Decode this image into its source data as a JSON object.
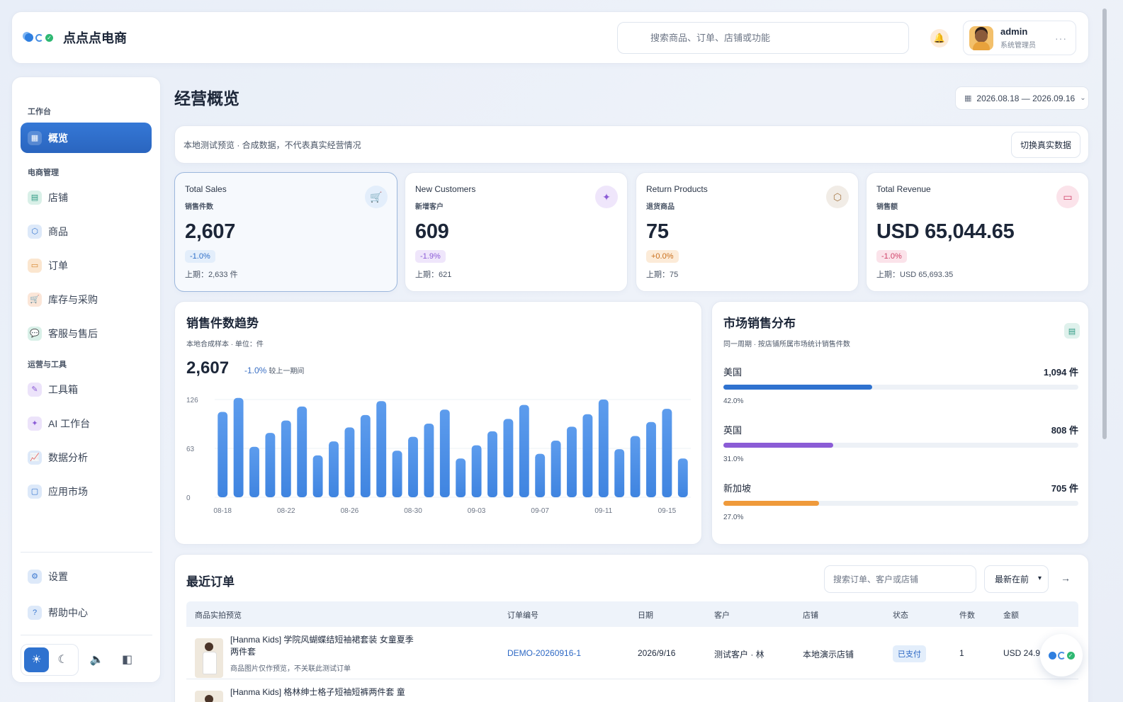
{
  "header": {
    "brand": "点点点电商",
    "search_placeholder": "搜索商品、订单、店铺或功能",
    "user_name": "admin",
    "user_role": "系统管理员"
  },
  "sidebar": {
    "sections": [
      {
        "label": "工作台"
      },
      {
        "label": "电商管理"
      },
      {
        "label": "运营与工具"
      }
    ],
    "items": [
      {
        "label": "概览",
        "icon": "grid-icon"
      },
      {
        "label": "店铺",
        "icon": "store-icon"
      },
      {
        "label": "商品",
        "icon": "box-icon"
      },
      {
        "label": "订单",
        "icon": "order-icon"
      },
      {
        "label": "库存与采购",
        "icon": "cart-icon"
      },
      {
        "label": "客服与售后",
        "icon": "chat-icon"
      },
      {
        "label": "工具箱",
        "icon": "magic-wand-icon"
      },
      {
        "label": "AI 工作台",
        "icon": "ai-star-icon"
      },
      {
        "label": "数据分析",
        "icon": "analytics-icon"
      },
      {
        "label": "应用市场",
        "icon": "app-market-icon"
      }
    ],
    "footer_items": [
      {
        "label": "设置",
        "icon": "gear-icon"
      },
      {
        "label": "帮助中心",
        "icon": "help-icon"
      }
    ]
  },
  "page": {
    "title": "经营概览",
    "date_range": "2026.08.18 — 2026.09.16",
    "notice": "本地测试预览 · 合成数据，不代表真实经营情况",
    "switch_button": "切换真实数据"
  },
  "kpis": [
    {
      "title": "Total Sales",
      "sub": "销售件数",
      "value": "2,607",
      "change": "-1.0%",
      "prev": "上期：2,633 件",
      "color": "#2f72cf"
    },
    {
      "title": "New Customers",
      "sub": "新增客户",
      "value": "609",
      "change": "-1.9%",
      "prev": "上期：621",
      "color": "#8b5cd6"
    },
    {
      "title": "Return Products",
      "sub": "退货商品",
      "value": "75",
      "change": "+0.0%",
      "prev": "上期：75",
      "color": "#d97a2b"
    },
    {
      "title": "Total Revenue",
      "sub": "销售额",
      "value": "USD 65,044.65",
      "change": "-1.0%",
      "prev": "上期：USD 65,693.35",
      "color": "#d9436b"
    }
  ],
  "trend": {
    "title": "销售件数趋势",
    "subtitle": "本地合成样本 · 单位：件",
    "total": "2,607",
    "change": "-1.0%",
    "change_label": "较上一期间"
  },
  "chart_data": {
    "type": "bar",
    "title": "销售件数趋势",
    "categories": [
      "08-18",
      "08-19",
      "08-20",
      "08-21",
      "08-22",
      "08-23",
      "08-24",
      "08-25",
      "08-26",
      "08-27",
      "08-28",
      "08-29",
      "08-30",
      "08-31",
      "09-01",
      "09-02",
      "09-03",
      "09-04",
      "09-05",
      "09-06",
      "09-07",
      "09-08",
      "09-09",
      "09-10",
      "09-11",
      "09-12",
      "09-13",
      "09-14",
      "09-15",
      "09-16"
    ],
    "tick_labels": [
      "08-18",
      "08-22",
      "08-26",
      "08-30",
      "09-03",
      "09-07",
      "09-11",
      "09-15"
    ],
    "tick_indices": [
      0,
      4,
      8,
      12,
      16,
      20,
      24,
      28
    ],
    "values": [
      110,
      128,
      65,
      83,
      99,
      117,
      54,
      72,
      90,
      106,
      124,
      60,
      78,
      95,
      113,
      50,
      67,
      85,
      101,
      119,
      56,
      73,
      91,
      107,
      126,
      62,
      79,
      97,
      114,
      50
    ],
    "yticks": [
      0,
      63,
      126
    ],
    "ylim": [
      0,
      126
    ],
    "color": "#4a8fe6"
  },
  "market": {
    "title": "市场销售分布",
    "subtitle": "同一周期 · 按店铺所属市场统计销售件数",
    "rows": [
      {
        "name": "美国",
        "count": "1,094 件",
        "pct_label": "42.0%",
        "pct": 0.42,
        "color": "#2f72cf"
      },
      {
        "name": "英国",
        "count": "808 件",
        "pct_label": "31.0%",
        "pct": 0.31,
        "color": "#8b5cd6"
      },
      {
        "name": "新加坡",
        "count": "705 件",
        "pct_label": "27.0%",
        "pct": 0.27,
        "color": "#ef9a3b"
      }
    ]
  },
  "orders": {
    "title": "最近订单",
    "search_placeholder": "搜索订单、客户或店铺",
    "sort": "最新在前",
    "columns": [
      "商品实拍预览",
      "订单编号",
      "日期",
      "客户",
      "店铺",
      "状态",
      "件数",
      "金额"
    ],
    "rows": [
      {
        "product": "[Hanma Kids] 学院风蝴蝶结短袖裙套装 女童夏季两件套",
        "note": "商品图片仅作预览，不关联此测试订单",
        "order_no": "DEMO-20260916-1",
        "date": "2026/9/16",
        "customer": "测试客户 · 林",
        "store": "本地演示店铺",
        "status": "已支付",
        "qty": "1",
        "amount": "USD 24.9"
      },
      {
        "product": "[Hanma Kids] 格林绅士格子短袖短裤两件套 童"
      }
    ]
  }
}
